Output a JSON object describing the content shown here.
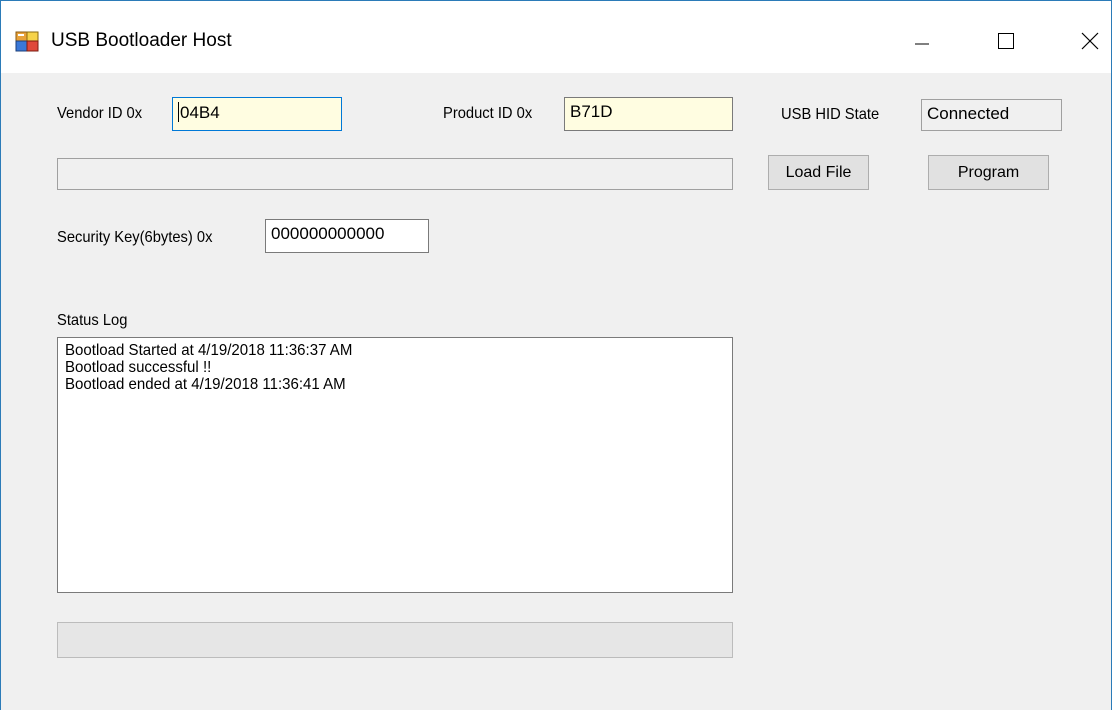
{
  "window": {
    "title": "USB Bootloader Host"
  },
  "form": {
    "vendor_label": "Vendor ID 0x",
    "vendor_value": "04B4",
    "product_label": "Product ID 0x",
    "product_value": "B71D",
    "state_label": "USB HID State",
    "state_value": "Connected",
    "file_path": "",
    "load_file_label": "Load File",
    "program_label": "Program",
    "security_label": "Security Key(6bytes) 0x",
    "security_value": "000000000000"
  },
  "status_log": {
    "label": "Status Log",
    "lines": [
      "Bootload Started at 4/19/2018 11:36:37 AM",
      "Bootload successful  !!",
      "Bootload ended at 4/19/2018 11:36:41 AM"
    ]
  },
  "progress": {
    "value": 0
  },
  "icons": {
    "app": "app-window-icon",
    "minimize": "minimize-icon",
    "maximize": "maximize-icon",
    "close": "close-icon"
  }
}
